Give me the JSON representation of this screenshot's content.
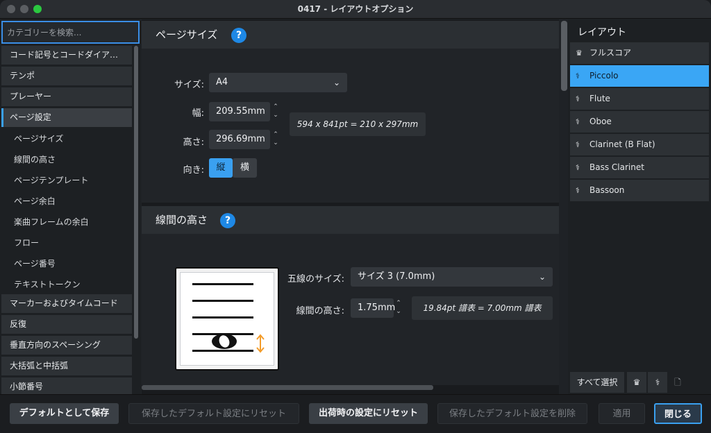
{
  "window": {
    "title": "0417 - レイアウトオプション"
  },
  "sidebar": {
    "search_placeholder": "カテゴリーを検索...",
    "categories_top": [
      "コード記号とコードダイア…",
      "テンポ",
      "プレーヤー"
    ],
    "active_category": "ページ設定",
    "subitems": [
      "ページサイズ",
      "線間の高さ",
      "ページテンプレート",
      "ページ余白",
      "楽曲フレームの余白",
      "フロー",
      "ページ番号",
      "テキストトークン"
    ],
    "categories_bottom": [
      "マーカーおよびタイムコード",
      "反復",
      "垂直方向のスペーシング",
      "大括弧と中括弧",
      "小節番号"
    ]
  },
  "page_size": {
    "heading": "ページサイズ",
    "help": "?",
    "size_label": "サイズ:",
    "size_value": "A4",
    "width_label": "幅:",
    "width_value": "209.55mm",
    "height_label": "高さ:",
    "height_value": "296.69mm",
    "dims_info": "594 x 841pt = 210 x 297mm",
    "orientation_label": "向き:",
    "orientation_portrait": "縦",
    "orientation_landscape": "横"
  },
  "staff_size": {
    "heading": "線間の高さ",
    "help": "?",
    "rastral_label": "五線のサイズ:",
    "rastral_value": "サイズ 3 (7.0mm)",
    "space_label": "線間の高さ:",
    "space_value": "1.75mm",
    "space_info": "19.84pt 譜表 = 7.00mm 譜表"
  },
  "layouts": {
    "heading": "レイアウト",
    "items": [
      {
        "label": "フルスコア",
        "icon": "full-score-icon"
      },
      {
        "label": "Piccolo",
        "icon": "part-icon"
      },
      {
        "label": "Flute",
        "icon": "part-icon"
      },
      {
        "label": "Oboe",
        "icon": "part-icon"
      },
      {
        "label": "Clarinet (B Flat)",
        "icon": "part-icon"
      },
      {
        "label": "Bass Clarinet",
        "icon": "part-icon"
      },
      {
        "label": "Bassoon",
        "icon": "part-icon"
      }
    ],
    "selected_index": 1,
    "select_all": "すべて選択"
  },
  "footer": {
    "save_default": "デフォルトとして保存",
    "reset_saved": "保存したデフォルト設定にリセット",
    "reset_factory": "出荷時の設定にリセット",
    "delete_saved": "保存したデフォルト設定を削除",
    "apply": "適用",
    "close": "閉じる"
  },
  "colors": {
    "accent": "#3aa0f0",
    "help": "#1e88e5",
    "arrow": "#f39c2a"
  }
}
